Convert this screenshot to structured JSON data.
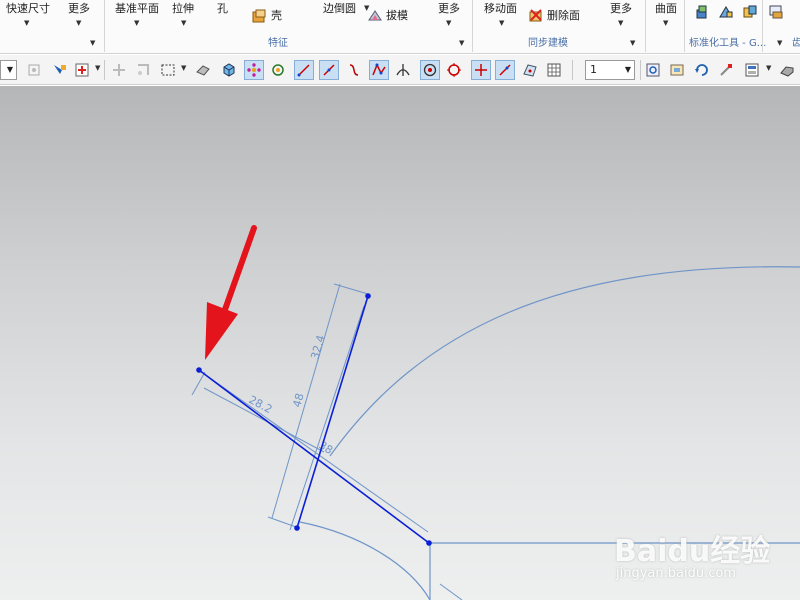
{
  "ribbon": {
    "quick_dimension": "快速尺寸",
    "more_1": "更多",
    "datum_plane": "基准平面",
    "extrude": "拉伸",
    "hole": "孔",
    "shell": "壳",
    "edge_blend": "边倒圆",
    "draft": "拔模",
    "more_2": "更多",
    "move_face": "移动面",
    "delete_face": "删除面",
    "more_3": "更多",
    "surface": "曲面",
    "group_feature": "特征",
    "group_sync_modeling": "同步建模",
    "group_standard_tools": "标准化工具 - G...",
    "group_truncated": "齿"
  },
  "toolbar": {
    "layer_value": "1"
  },
  "sketch": {
    "dims": {
      "d1": "32.4",
      "d2": "28.2",
      "d3": "48",
      "d4": "38"
    },
    "line_color": "#0a1fd6",
    "dim_color": "#6f95c8",
    "arrow_color": "#e3141b"
  },
  "watermark": {
    "logo": "Baidu经验",
    "url": "jingyan.baidu.com"
  },
  "colors": {
    "ribbon_bg": "#fbfbfb",
    "toolbar_bg": "#f4f4f4",
    "group_label": "#4a6fa5",
    "active_tool_bg": "#c9dff3"
  }
}
